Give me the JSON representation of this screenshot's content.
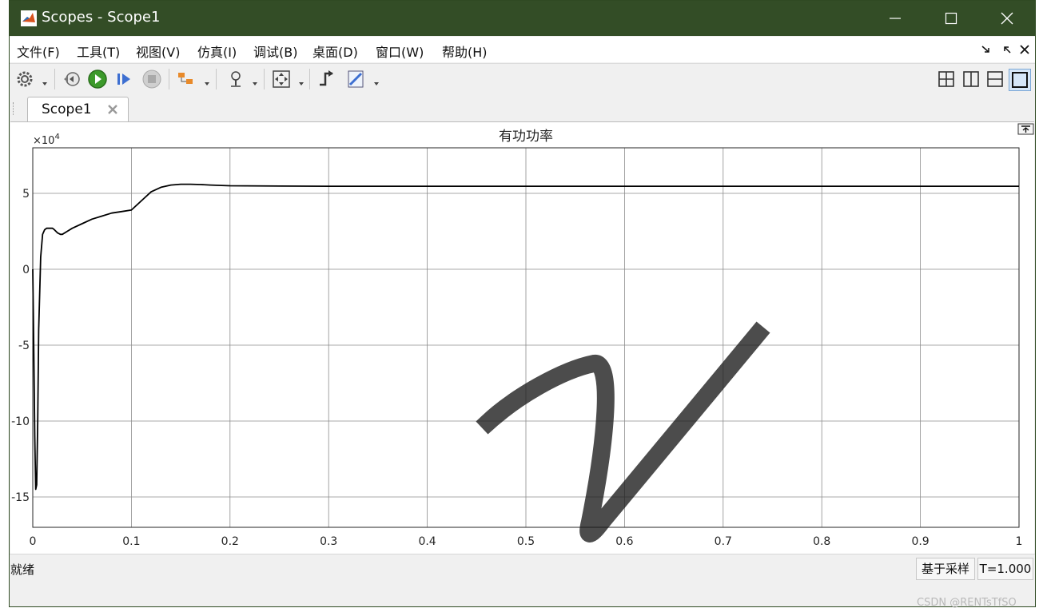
{
  "window": {
    "title": "Scopes - Scope1",
    "titlebar_color": "#334d26"
  },
  "menu": {
    "items": [
      {
        "label": "文件(F)"
      },
      {
        "label": "工具(T)"
      },
      {
        "label": "视图(V)"
      },
      {
        "label": "仿真(I)"
      },
      {
        "label": "调试(B)"
      },
      {
        "label": "桌面(D)"
      },
      {
        "label": "窗口(W)"
      },
      {
        "label": "帮助(H)"
      }
    ]
  },
  "toolbar": {
    "icons": [
      "gear-icon",
      "step-back-icon",
      "run-icon",
      "step-forward-icon",
      "stop-icon",
      "signal-select-icon",
      "zoom-icon",
      "autoscale-icon",
      "trigger-icon",
      "measure-icon"
    ],
    "layout_icons": [
      "layout-grid-icon",
      "layout-columns-icon",
      "layout-rows-icon",
      "layout-single-icon"
    ]
  },
  "tab": {
    "label": "Scope1"
  },
  "chart_data": {
    "type": "line",
    "title": "有功功率",
    "exponent_label": "×10",
    "exponent_power": "4",
    "xlim": [
      0,
      1
    ],
    "ylim": [
      -17,
      8
    ],
    "x_ticks": [
      "0",
      "0.1",
      "0.2",
      "0.3",
      "0.4",
      "0.5",
      "0.6",
      "0.7",
      "0.8",
      "0.9",
      "1"
    ],
    "y_ticks": [
      {
        "value": 5,
        "label": "5"
      },
      {
        "value": 0,
        "label": "0"
      },
      {
        "value": -5,
        "label": "-5"
      },
      {
        "value": -10,
        "label": "-10"
      },
      {
        "value": -15,
        "label": "-15"
      }
    ],
    "grid": true,
    "series": [
      {
        "color": "#000000",
        "x": [
          0,
          0.001,
          0.002,
          0.003,
          0.004,
          0.005,
          0.006,
          0.008,
          0.01,
          0.012,
          0.014,
          0.016,
          0.018,
          0.02,
          0.022,
          0.025,
          0.028,
          0.03,
          0.035,
          0.04,
          0.05,
          0.06,
          0.07,
          0.08,
          0.09,
          0.1,
          0.11,
          0.12,
          0.13,
          0.14,
          0.15,
          0.16,
          0.17,
          0.18,
          0.2,
          0.25,
          0.3,
          0.4,
          0.5,
          0.6,
          0.7,
          0.8,
          0.9,
          1.0
        ],
        "y": [
          0,
          -5,
          -11,
          -14.5,
          -14.2,
          -10,
          -4,
          0.8,
          2.3,
          2.6,
          2.7,
          2.7,
          2.7,
          2.7,
          2.6,
          2.4,
          2.3,
          2.3,
          2.5,
          2.7,
          3.0,
          3.3,
          3.5,
          3.7,
          3.8,
          3.9,
          4.5,
          5.1,
          5.4,
          5.55,
          5.6,
          5.6,
          5.58,
          5.55,
          5.5,
          5.48,
          5.47,
          5.47,
          5.47,
          5.47,
          5.47,
          5.47,
          5.47,
          5.47
        ]
      }
    ]
  },
  "status": {
    "left_text": "就绪",
    "mode": "基于采样",
    "time": "T=1.000"
  },
  "watermark": "CSDN @RENTsTfSO"
}
